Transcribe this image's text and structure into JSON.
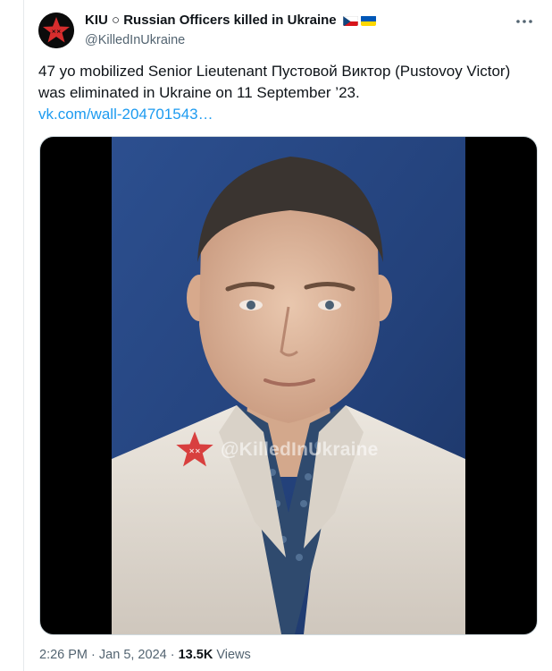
{
  "tweet": {
    "author": {
      "name": "KIU ○ Russian Officers killed in Ukraine",
      "handle": "@KilledInUkraine",
      "avatar_icon": "red-star-icon",
      "flags": [
        "czech-flag-icon",
        "ukraine-flag-icon"
      ]
    },
    "text_line1": "47 yo mobilized Senior Lieutenant Пустовой Виктор (Pustovoy Victor)",
    "text_line2": "was eliminated in Ukraine on 11 September ’23.",
    "link": "vk.com/wall-204701543…",
    "media": {
      "watermark_text": "@KilledInUkraine",
      "watermark_icon": "red-star-icon"
    },
    "time": "2:26 PM",
    "separator": "·",
    "date": "Jan 5, 2024",
    "views_count": "13.5K",
    "views_label": "Views"
  },
  "colors": {
    "accent_link": "#1d9bf0",
    "secondary_text": "#536471",
    "star_red": "#d62d2d"
  }
}
